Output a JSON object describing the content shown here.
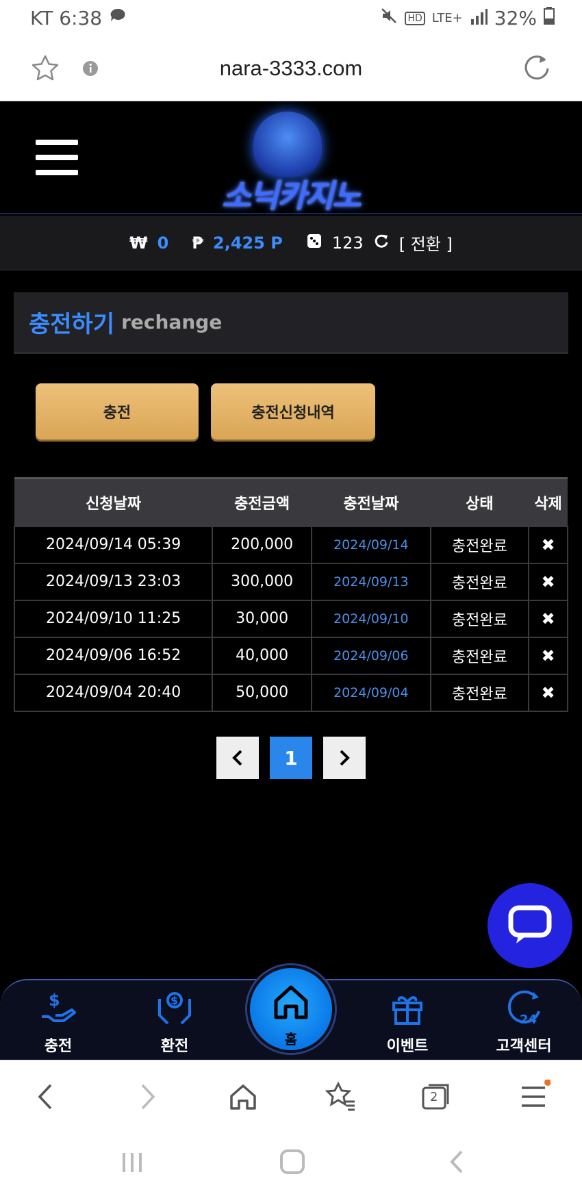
{
  "status": {
    "carrier_time": "KT 6:38",
    "network": "LTE+",
    "battery": "32%"
  },
  "browser": {
    "url": "nara-3333.com"
  },
  "site": {
    "logo_text": "소닉카지노"
  },
  "balance": {
    "won_symbol": "₩",
    "won": "0",
    "point_symbol": "₱",
    "points": "2,425 P",
    "chips": "123",
    "switch_label": "[ 전환 ]"
  },
  "section": {
    "title_ko": "충전하기",
    "title_en": "rechange"
  },
  "buttons": {
    "charge": "충전",
    "history": "충전신청내역"
  },
  "table": {
    "headers": [
      "신청날짜",
      "충전금액",
      "충전날짜",
      "상태",
      "삭제"
    ],
    "rows": [
      [
        "2024/09/14 05:39",
        "200,000",
        "2024/09/14",
        "충전완료",
        "✖"
      ],
      [
        "2024/09/13 23:03",
        "300,000",
        "2024/09/13",
        "충전완료",
        "✖"
      ],
      [
        "2024/09/10 11:25",
        "30,000",
        "2024/09/10",
        "충전완료",
        "✖"
      ],
      [
        "2024/09/06 16:52",
        "40,000",
        "2024/09/06",
        "충전완료",
        "✖"
      ],
      [
        "2024/09/04 20:40",
        "50,000",
        "2024/09/04",
        "충전완료",
        "✖"
      ]
    ]
  },
  "pager": {
    "prev": "‹",
    "page": "1",
    "next": "›"
  },
  "bottom_nav": {
    "charge": "충전",
    "exchange": "환전",
    "home": "홈",
    "event": "이벤트",
    "support": "고객센터"
  },
  "browser_nav": {
    "tabs_count": "2"
  },
  "colors": {
    "accent_blue": "#3b8cff",
    "button_gold": "#e6b56a",
    "chat_blue": "#2323e0"
  }
}
